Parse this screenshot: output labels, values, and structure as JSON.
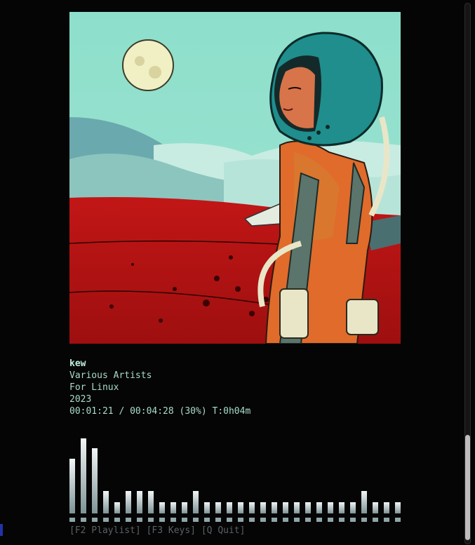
{
  "player": {
    "title": "kew",
    "artist": "Various Artists",
    "album": "For Linux",
    "year": "2023",
    "progress": "00:01:21 / 00:04:28 (30%) T:0h04m",
    "progress_fraction": 0.3
  },
  "footer": {
    "keys": "[F2 Playlist] [F3 Keys] [Q Quit]"
  },
  "visualizer": {
    "levels": [
      0.62,
      0.85,
      0.74,
      0.25,
      0.13,
      0.25,
      0.25,
      0.25,
      0.13,
      0.13,
      0.13,
      0.25,
      0.13,
      0.13,
      0.13,
      0.13,
      0.13,
      0.13,
      0.13,
      0.13,
      0.13,
      0.13,
      0.13,
      0.13,
      0.13,
      0.13,
      0.25,
      0.13,
      0.13,
      0.13
    ]
  },
  "colors": {
    "text": "#a8dcc8",
    "footer": "#5b6166",
    "bar_top": "#f2f6f6",
    "bar_bottom": "#7e9396"
  },
  "icons": {
    "cursor": "block-cursor"
  }
}
